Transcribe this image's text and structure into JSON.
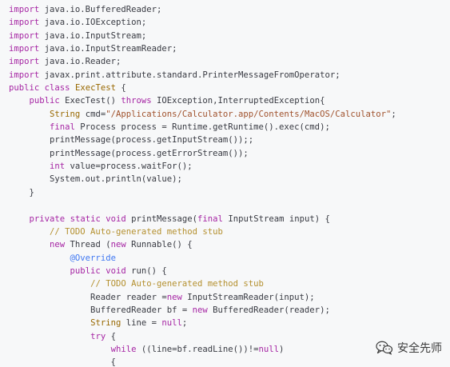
{
  "code": {
    "lines": [
      [
        {
          "t": "kw",
          "v": "import"
        },
        {
          "t": "plain",
          "v": " java.io.BufferedReader;"
        }
      ],
      [
        {
          "t": "kw",
          "v": "import"
        },
        {
          "t": "plain",
          "v": " java.io.IOException;"
        }
      ],
      [
        {
          "t": "kw",
          "v": "import"
        },
        {
          "t": "plain",
          "v": " java.io.InputStream;"
        }
      ],
      [
        {
          "t": "kw",
          "v": "import"
        },
        {
          "t": "plain",
          "v": " java.io.InputStreamReader;"
        }
      ],
      [
        {
          "t": "kw",
          "v": "import"
        },
        {
          "t": "plain",
          "v": " java.io.Reader;"
        }
      ],
      [
        {
          "t": "kw",
          "v": "import"
        },
        {
          "t": "plain",
          "v": " javax.print.attribute.standard.PrinterMessageFromOperator;"
        }
      ],
      [
        {
          "t": "kw",
          "v": "public"
        },
        {
          "t": "plain",
          "v": " "
        },
        {
          "t": "kw",
          "v": "class"
        },
        {
          "t": "plain",
          "v": " "
        },
        {
          "t": "type",
          "v": "ExecTest"
        },
        {
          "t": "plain",
          "v": " {"
        }
      ],
      [
        {
          "t": "plain",
          "v": "    "
        },
        {
          "t": "kw",
          "v": "public"
        },
        {
          "t": "plain",
          "v": " ExecTest() "
        },
        {
          "t": "kw",
          "v": "throws"
        },
        {
          "t": "plain",
          "v": " IOException,InterruptedException{"
        }
      ],
      [
        {
          "t": "plain",
          "v": "        "
        },
        {
          "t": "type",
          "v": "String"
        },
        {
          "t": "plain",
          "v": " cmd="
        },
        {
          "t": "str2",
          "v": "\"/Applications/Calculator.app/Contents/MacOS/Calculator\""
        },
        {
          "t": "plain",
          "v": ";"
        }
      ],
      [
        {
          "t": "plain",
          "v": "        "
        },
        {
          "t": "kw",
          "v": "final"
        },
        {
          "t": "plain",
          "v": " Process process = Runtime.getRuntime().exec(cmd);"
        }
      ],
      [
        {
          "t": "plain",
          "v": "        printMessage(process.getInputStream());;"
        }
      ],
      [
        {
          "t": "plain",
          "v": "        printMessage(process.getErrorStream());"
        }
      ],
      [
        {
          "t": "plain",
          "v": "        "
        },
        {
          "t": "kw",
          "v": "int"
        },
        {
          "t": "plain",
          "v": " value=process.waitFor();"
        }
      ],
      [
        {
          "t": "plain",
          "v": "        System.out.println(value);"
        }
      ],
      [
        {
          "t": "plain",
          "v": "    }"
        }
      ],
      [
        {
          "t": "plain",
          "v": ""
        }
      ],
      [
        {
          "t": "plain",
          "v": "    "
        },
        {
          "t": "kw",
          "v": "private"
        },
        {
          "t": "plain",
          "v": " "
        },
        {
          "t": "kw",
          "v": "static"
        },
        {
          "t": "plain",
          "v": " "
        },
        {
          "t": "kw",
          "v": "void"
        },
        {
          "t": "plain",
          "v": " printMessage("
        },
        {
          "t": "kw",
          "v": "final"
        },
        {
          "t": "plain",
          "v": " InputStream input) {"
        }
      ],
      [
        {
          "t": "plain",
          "v": "        "
        },
        {
          "t": "comment",
          "v": "// TODO Auto-generated method stub"
        }
      ],
      [
        {
          "t": "plain",
          "v": "        "
        },
        {
          "t": "kw",
          "v": "new"
        },
        {
          "t": "plain",
          "v": " Thread ("
        },
        {
          "t": "kw",
          "v": "new"
        },
        {
          "t": "plain",
          "v": " Runnable() {"
        }
      ],
      [
        {
          "t": "plain",
          "v": "            "
        },
        {
          "t": "anno",
          "v": "@Override"
        }
      ],
      [
        {
          "t": "plain",
          "v": "            "
        },
        {
          "t": "kw",
          "v": "public"
        },
        {
          "t": "plain",
          "v": " "
        },
        {
          "t": "kw",
          "v": "void"
        },
        {
          "t": "plain",
          "v": " run() {"
        }
      ],
      [
        {
          "t": "plain",
          "v": "                "
        },
        {
          "t": "comment",
          "v": "// TODO Auto-generated method stub"
        }
      ],
      [
        {
          "t": "plain",
          "v": "                Reader reader ="
        },
        {
          "t": "kw",
          "v": "new"
        },
        {
          "t": "plain",
          "v": " InputStreamReader(input);"
        }
      ],
      [
        {
          "t": "plain",
          "v": "                BufferedReader bf = "
        },
        {
          "t": "kw",
          "v": "new"
        },
        {
          "t": "plain",
          "v": " BufferedReader(reader);"
        }
      ],
      [
        {
          "t": "plain",
          "v": "                "
        },
        {
          "t": "type",
          "v": "String"
        },
        {
          "t": "plain",
          "v": " line = "
        },
        {
          "t": "kw",
          "v": "null"
        },
        {
          "t": "plain",
          "v": ";"
        }
      ],
      [
        {
          "t": "plain",
          "v": "                "
        },
        {
          "t": "kw",
          "v": "try"
        },
        {
          "t": "plain",
          "v": " {"
        }
      ],
      [
        {
          "t": "plain",
          "v": "                    "
        },
        {
          "t": "kw",
          "v": "while"
        },
        {
          "t": "plain",
          "v": " ((line=bf.readLine())!="
        },
        {
          "t": "kw",
          "v": "null"
        },
        {
          "t": "plain",
          "v": ")"
        }
      ],
      [
        {
          "t": "plain",
          "v": "                    {"
        }
      ]
    ]
  },
  "watermark": {
    "text": "安全先师",
    "icon": "wechat-icon"
  }
}
